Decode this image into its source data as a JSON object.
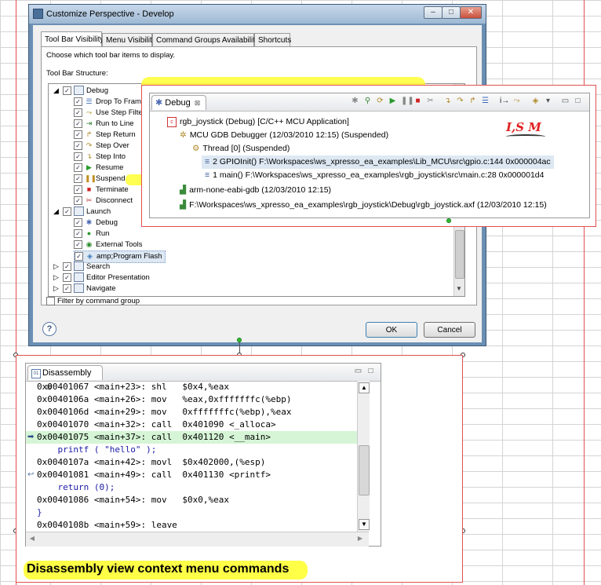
{
  "dialog": {
    "title": "Customize Perspective - Develop",
    "win_min": "–",
    "win_max": "□",
    "win_close": "✕",
    "tabs": [
      {
        "label": "Tool Bar Visibility"
      },
      {
        "label": "Menu Visibility"
      },
      {
        "label": "Command Groups Availability"
      },
      {
        "label": "Shortcuts"
      }
    ],
    "instruction": "Choose which tool bar items to display.",
    "structure_label": "Tool Bar Structure:",
    "tree": [
      {
        "label": "Debug"
      },
      {
        "label": "Drop To Frame"
      },
      {
        "label": "Use Step Filters"
      },
      {
        "label": "Run to Line"
      },
      {
        "label": "Step Return"
      },
      {
        "label": "Step Over"
      },
      {
        "label": "Step Into"
      },
      {
        "label": "Resume"
      },
      {
        "label": "Suspend"
      },
      {
        "label": "Terminate"
      },
      {
        "label": "Disconnect"
      },
      {
        "label": "Launch"
      },
      {
        "label": "Debug"
      },
      {
        "label": "Run"
      },
      {
        "label": "External Tools"
      },
      {
        "label": "amp;Program Flash"
      },
      {
        "label": "Search"
      },
      {
        "label": "Editor Presentation"
      },
      {
        "label": "Navigate"
      }
    ],
    "filter_label": "Filter by command group",
    "help": "?",
    "ok_label": "OK",
    "cancel_label": "Cancel"
  },
  "debug_view": {
    "tab_label": "Debug",
    "tab_close": "⊠",
    "annotation": "I,S M",
    "rows": [
      {
        "text": "rgb_joystick (Debug) [C/C++ MCU Application]"
      },
      {
        "text": "MCU GDB Debugger (12/03/2010 12:15) (Suspended)"
      },
      {
        "text": "Thread [0] (Suspended)"
      },
      {
        "text": "2 GPIOInit() F:\\Workspaces\\ws_xpresso_ea_examples\\Lib_MCU\\src\\gpio.c:144 0x000004ac"
      },
      {
        "text": "1 main() F:\\Workspaces\\ws_xpresso_ea_examples\\rgb_joystick\\src\\main.c:28 0x000001d4"
      },
      {
        "text": "arm-none-eabi-gdb (12/03/2010 12:15)"
      },
      {
        "text": "F:\\Workspaces\\ws_xpresso_ea_examples\\rgb_joystick\\Debug\\rgb_joystick.axf (12/03/2010 12:15)"
      }
    ]
  },
  "disassembly": {
    "tab_label": "Disassembly",
    "tab_close": "⊠",
    "lines": [
      {
        "text": "0x00401067 <main+23>: shl   $0x4,%eax"
      },
      {
        "text": "0x0040106a <main+26>: mov   %eax,0xfffffffc(%ebp)"
      },
      {
        "text": "0x0040106d <main+29>: mov   0xfffffffc(%ebp),%eax"
      },
      {
        "text": "0x00401070 <main+32>: call  0x401090 <_alloca>"
      },
      {
        "text": "0x00401075 <main+37>: call  0x401120 <__main>"
      },
      {
        "text": "    printf ( \"hello\" );"
      },
      {
        "text": "0x0040107a <main+42>: movl  $0x402000,(%esp)"
      },
      {
        "text": "0x00401081 <main+49>: call  0x401130 <printf>"
      },
      {
        "text": "    return (0);"
      },
      {
        "text": "0x00401086 <main+54>: mov   $0x0,%eax"
      },
      {
        "text": "}"
      },
      {
        "text": "0x0040108b <main+59>: leave"
      }
    ]
  },
  "caption": "Disassembly view context menu commands",
  "colors": {
    "highlight": "#ffff33",
    "selection_row": "#dde8f3",
    "current_line": "#d6f5d6",
    "source_text": "#1a1aa6",
    "frame_red": "#e05050"
  }
}
